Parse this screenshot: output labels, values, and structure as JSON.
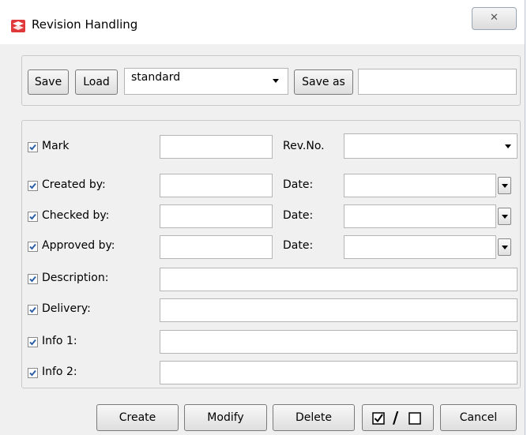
{
  "window": {
    "title": "Revision Handling",
    "close_glyph": "✕"
  },
  "toolbar": {
    "save_label": "Save",
    "load_label": "Load",
    "profile_value": "standard",
    "save_as_label": "Save as",
    "save_as_name": ""
  },
  "fields": {
    "mark": {
      "label": "Mark",
      "checked": true,
      "value": ""
    },
    "rev_no": {
      "label": "Rev.No.",
      "value": ""
    },
    "created_by": {
      "label": "Created by:",
      "checked": true,
      "value": ""
    },
    "created_date": {
      "label": "Date:",
      "value": ""
    },
    "checked_by": {
      "label": "Checked by:",
      "checked": true,
      "value": ""
    },
    "checked_date": {
      "label": "Date:",
      "value": ""
    },
    "approved_by": {
      "label": "Approved by:",
      "checked": true,
      "value": ""
    },
    "approved_date": {
      "label": "Date:",
      "value": ""
    },
    "description": {
      "label": "Description:",
      "checked": true,
      "value": ""
    },
    "delivery": {
      "label": "Delivery:",
      "checked": true,
      "value": ""
    },
    "info1": {
      "label": "Info 1:",
      "checked": true,
      "value": ""
    },
    "info2": {
      "label": "Info 2:",
      "checked": true,
      "value": ""
    }
  },
  "footer": {
    "create_label": "Create",
    "modify_label": "Modify",
    "delete_label": "Delete",
    "toggle_separator": "/",
    "cancel_label": "Cancel"
  },
  "colors": {
    "check_blue": "#2d5fa8",
    "icon_red": "#e0383a"
  }
}
